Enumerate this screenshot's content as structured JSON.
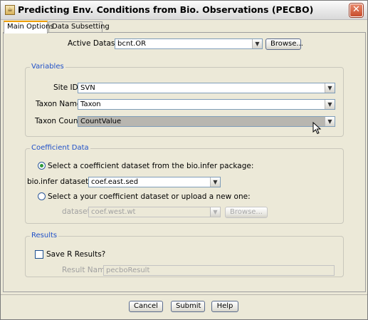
{
  "window": {
    "title": "Predicting Env. Conditions from Bio. Observations (PECBO)"
  },
  "tabs": [
    {
      "label": "Main Options"
    },
    {
      "label": "Data Subsetting"
    }
  ],
  "active_dataset": {
    "label": "Active Dataset:",
    "value": "bcnt.OR",
    "browse_label": "Browse..."
  },
  "variables": {
    "title": "Variables",
    "site_id": {
      "label": "Site ID:",
      "value": "SVN"
    },
    "taxon_name": {
      "label": "Taxon Name:",
      "value": "Taxon"
    },
    "taxon_count": {
      "label": "Taxon Count:",
      "value": "CountValue"
    }
  },
  "coefficient": {
    "title": "Coefficient Data",
    "option1": "Select a coefficient dataset from the bio.infer package:",
    "bioinfer_label": "bio.infer dataset:",
    "bioinfer_value": "coef.east.sed",
    "option2": "Select a your coefficient dataset or upload a new one:",
    "dataset_label": "dataset:",
    "dataset_value": "coef.west.wt",
    "browse_label": "Browse..."
  },
  "results": {
    "title": "Results",
    "save_label": "Save R Results?",
    "result_name_label": "Result Name:",
    "result_name_value": "pecboResult"
  },
  "footer": {
    "cancel": "Cancel",
    "submit": "Submit",
    "help": "Help"
  },
  "colors": {
    "group_title": "#2050c8",
    "close_button": "#c84d2c",
    "tab_accent": "#f0a000"
  }
}
